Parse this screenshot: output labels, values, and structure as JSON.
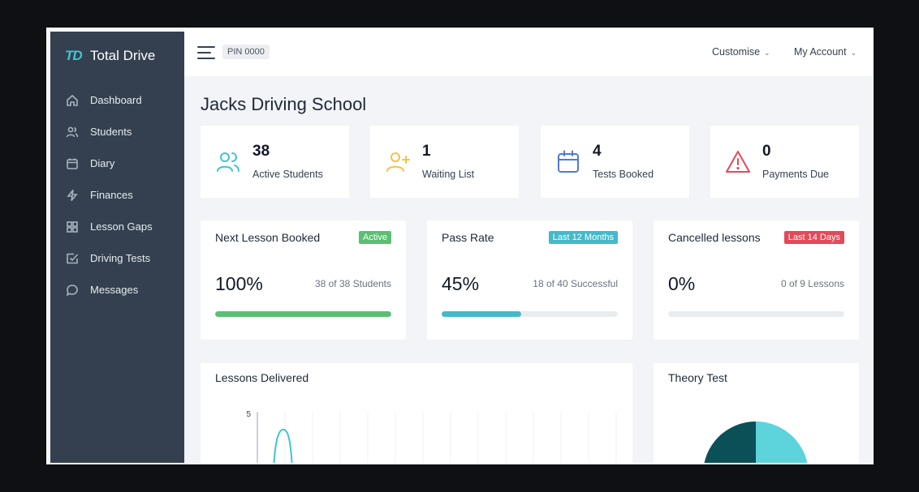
{
  "app": {
    "brand_logo": "TD",
    "brand_name": "Total Drive"
  },
  "sidebar": {
    "items": [
      {
        "label": "Dashboard",
        "icon": "home-icon"
      },
      {
        "label": "Students",
        "icon": "users-icon"
      },
      {
        "label": "Diary",
        "icon": "calendar-icon"
      },
      {
        "label": "Finances",
        "icon": "lightning-icon"
      },
      {
        "label": "Lesson Gaps",
        "icon": "grid-icon"
      },
      {
        "label": "Driving Tests",
        "icon": "checkbox-icon"
      },
      {
        "label": "Messages",
        "icon": "message-icon"
      }
    ]
  },
  "topbar": {
    "pin": "PIN 0000",
    "customise": "Customise",
    "account": "My Account"
  },
  "page": {
    "title": "Jacks Driving School"
  },
  "stats": [
    {
      "value": "38",
      "label": "Active Students",
      "color": "#3ec6cf",
      "icon": "users-icon"
    },
    {
      "value": "1",
      "label": "Waiting List",
      "color": "#f5c242",
      "icon": "add-user-icon"
    },
    {
      "value": "4",
      "label": "Tests Booked",
      "color": "#4f7ad9",
      "icon": "calendar-icon"
    },
    {
      "value": "0",
      "label": "Payments Due",
      "color": "#e04b5a",
      "icon": "warning-icon"
    }
  ],
  "metrics": [
    {
      "title": "Next Lesson Booked",
      "badge": "Active",
      "badge_color": "#5cbf73",
      "value": "100%",
      "sub": "38 of 38 Students",
      "progress": 1.0,
      "progress_color": "#5cbf73"
    },
    {
      "title": "Pass Rate",
      "badge": "Last 12 Months",
      "badge_color": "#45b9c9",
      "value": "45%",
      "sub": "18 of 40 Successful",
      "progress": 0.45,
      "progress_color": "#45b9c9"
    },
    {
      "title": "Cancelled lessons",
      "badge": "Last 14 Days",
      "badge_color": "#e04b5a",
      "value": "0%",
      "sub": "0 of 9 Lessons",
      "progress": 0.0,
      "progress_color": "#e04b5a"
    }
  ],
  "lessons_panel": {
    "title": "Lessons Delivered",
    "y_tick": "5"
  },
  "theory_panel": {
    "title": "Theory Test"
  },
  "chart_data": [
    {
      "type": "line",
      "title": "Lessons Delivered",
      "y_ticks": [
        "5"
      ],
      "series_color": "#3ec6cf"
    },
    {
      "type": "pie",
      "title": "Theory Test",
      "colors": [
        "#0b4f57",
        "#5dd3dc"
      ]
    }
  ]
}
